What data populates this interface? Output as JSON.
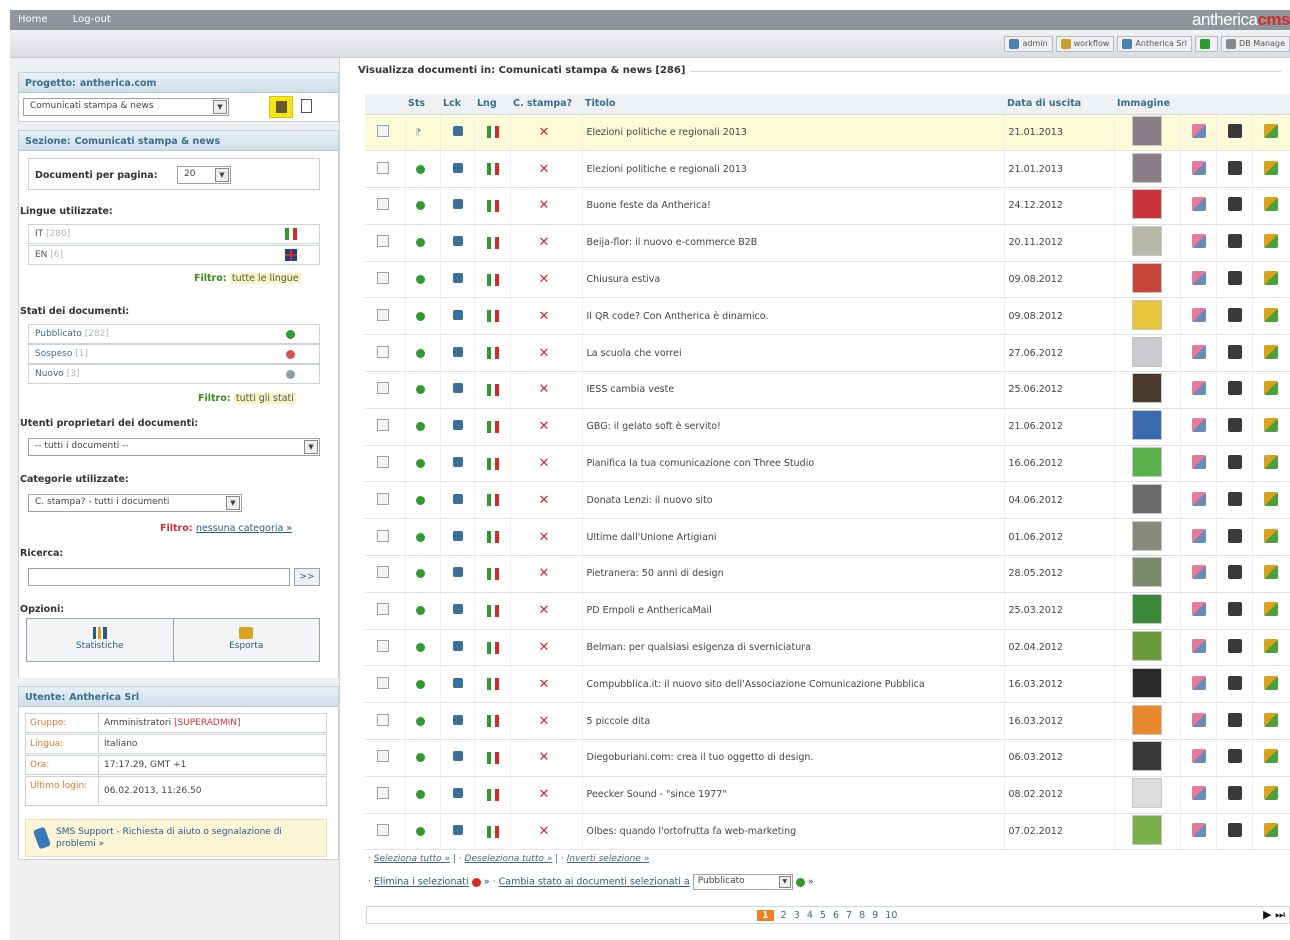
{
  "topbar": {
    "nav": [
      "Home",
      "Log-out"
    ],
    "logo_main": "antherica",
    "logo_accent": "cms"
  },
  "subbar": {
    "buttons": [
      {
        "label": "admin",
        "icon": "gear-icon",
        "color": "#4a7fb0"
      },
      {
        "label": "workflow",
        "icon": "workflow-icon",
        "color": "#c9a12a"
      },
      {
        "label": "Antherica Srl",
        "icon": "company-icon",
        "color": "#4a7fb0"
      },
      {
        "label": "",
        "icon": "italy-flag-icon",
        "color": "#2f9a2f"
      },
      {
        "label": "DB Manage",
        "icon": "database-icon",
        "color": "#888888"
      }
    ]
  },
  "left": {
    "project_label": "Progetto:",
    "project_name": "antherica.com",
    "project_select": "Comunicati stampa & news",
    "section_label": "Sezione:",
    "section_name": "Comunicati stampa & news",
    "docs_per_page_label": "Documenti per pagina:",
    "docs_per_page_value": "20",
    "languages_label": "Lingue utilizzate:",
    "languages": [
      {
        "code": "IT",
        "count": "[280]"
      },
      {
        "code": "EN",
        "count": "[6]"
      }
    ],
    "lang_filter_label": "Filtro:",
    "lang_filter_value": "tutte le lingue",
    "states_label": "Stati dei documenti:",
    "states": [
      {
        "name": "Pubblicato",
        "count": "[282]",
        "color": "#2f9a2f"
      },
      {
        "name": "Sospeso",
        "count": "[1]",
        "color": "#d35353"
      },
      {
        "name": "Nuovo",
        "count": "[3]",
        "color": "#8aa0b0"
      }
    ],
    "state_filter_label": "Filtro:",
    "state_filter_value": "tutti gli stati",
    "owners_label": "Utenti proprietari dei documenti:",
    "owners_select": "-- tutti i documenti --",
    "categories_label": "Categorie utilizzate:",
    "categories_select": "C. stampa? - tutti i documenti",
    "cat_filter_label": "Filtro:",
    "cat_filter_value": "nessuna categoria »",
    "search_label": "Ricerca:",
    "search_btn": ">>",
    "options_label": "Opzioni:",
    "opt_stats": "Statistiche",
    "opt_export": "Esporta",
    "user_label": "Utente:",
    "user_name": "Antherica Srl",
    "user_info": [
      {
        "k": "Gruppo:",
        "v": "Amministratori",
        "extra": "[SUPERADMIN]"
      },
      {
        "k": "Lingua:",
        "v": "Italiano",
        "extra": ""
      },
      {
        "k": "Ora:",
        "v": "17:17.29, GMT +1",
        "extra": ""
      },
      {
        "k": "Ultimo login:",
        "v": "06.02.2013, 11:26.50",
        "extra": ""
      }
    ],
    "support_text": "SMS Support - Richiesta di aiuto o segnalazione di problemi »"
  },
  "main": {
    "title": "Visualizza documenti in: Comunicati stampa & news [286]",
    "headers": [
      "",
      "Sts",
      "Lck",
      "Lng",
      "C. stampa?",
      "Titolo",
      "Data di uscita",
      "Immagine",
      "",
      "",
      ""
    ],
    "rows": [
      {
        "title": "Elezioni politiche e regionali 2013",
        "date": "21.01.2013",
        "status": "new",
        "thumb": "#8a7f86"
      },
      {
        "title": "Elezioni politiche e regionali 2013",
        "date": "21.01.2013",
        "status": "pub",
        "thumb": "#8a7f86"
      },
      {
        "title": "Buone feste da Antherica!",
        "date": "24.12.2012",
        "status": "pub",
        "thumb": "#c8343a"
      },
      {
        "title": "Beija-flor: il nuovo e-commerce B2B",
        "date": "20.11.2012",
        "status": "pub",
        "thumb": "#b8b8a8"
      },
      {
        "title": "Chiusura estiva",
        "date": "09.08.2012",
        "status": "pub",
        "thumb": "#c6463a"
      },
      {
        "title": "Il QR code? Con Antherica è dinamico.",
        "date": "09.08.2012",
        "status": "pub",
        "thumb": "#e8c43a"
      },
      {
        "title": "La scuola che vorrei",
        "date": "27.06.2012",
        "status": "pub",
        "thumb": "#c8ccd0"
      },
      {
        "title": "IESS cambia veste",
        "date": "25.06.2012",
        "status": "pub",
        "thumb": "#4a3a2a"
      },
      {
        "title": "GBG: il gelato soft è servito!",
        "date": "21.06.2012",
        "status": "pub",
        "thumb": "#3a6ab0"
      },
      {
        "title": "Pianifica la tua comunicazione con Three Studio",
        "date": "16.06.2012",
        "status": "pub",
        "thumb": "#5ab04a"
      },
      {
        "title": "Donata Lenzi: il nuovo sito",
        "date": "04.06.2012",
        "status": "pub",
        "thumb": "#6a6a6a"
      },
      {
        "title": "Ultime dall'Unione Artigiani",
        "date": "01.06.2012",
        "status": "pub",
        "thumb": "#8a8a7a"
      },
      {
        "title": "Pietranera: 50 anni di design",
        "date": "28.05.2012",
        "status": "pub",
        "thumb": "#7a8a6a"
      },
      {
        "title": "PD Empoli e AnthericaMail",
        "date": "25.03.2012",
        "status": "pub",
        "thumb": "#3a8a3a"
      },
      {
        "title": "Belman: per qualsiasi esigenza di sverniciatura",
        "date": "02.04.2012",
        "status": "pub",
        "thumb": "#6a9a3a"
      },
      {
        "title": "Compubblica.it: il nuovo sito dell'Associazione Comunicazione Pubblica",
        "date": "16.03.2012",
        "status": "pub",
        "thumb": "#2a2a2a"
      },
      {
        "title": "5 piccole dita",
        "date": "16.03.2012",
        "status": "pub",
        "thumb": "#e8882a"
      },
      {
        "title": "Diegoburiani.com: crea il tuo oggetto di design.",
        "date": "06.03.2012",
        "status": "pub",
        "thumb": "#3a3a3a"
      },
      {
        "title": "Peecker Sound - \"since 1977\"",
        "date": "08.02.2012",
        "status": "pub",
        "thumb": "#dcdcdc"
      },
      {
        "title": "Olbes: quando l'ortofrutta fa web-marketing",
        "date": "07.02.2012",
        "status": "pub",
        "thumb": "#7ab04a"
      }
    ],
    "select_all": "Seleziona tutto »",
    "deselect_all": "Deseleziona tutto »",
    "invert": "Inverti selezione »",
    "delete_selected": "Elimina i selezionati",
    "change_state": "Cambia stato ai documenti selezionati a",
    "state_value": "Pubblicato",
    "pages": [
      "1",
      "2",
      "3",
      "4",
      "5",
      "6",
      "7",
      "8",
      "9",
      "10"
    ]
  }
}
